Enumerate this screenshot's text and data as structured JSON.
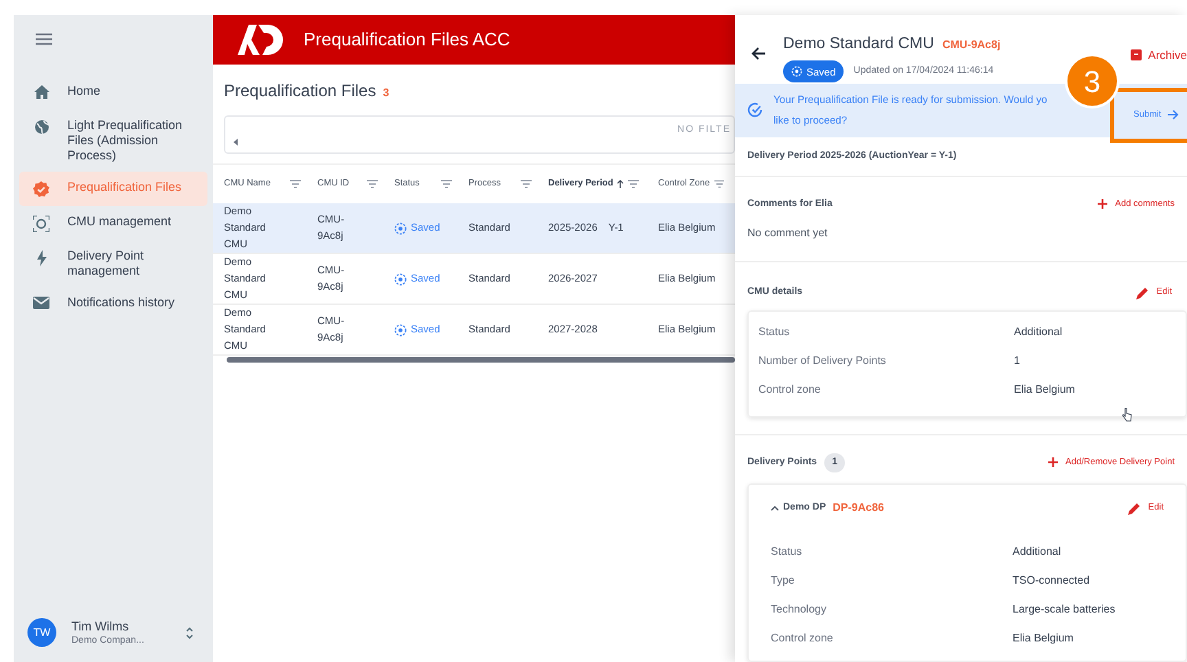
{
  "sidebar": {
    "items": [
      {
        "label": "Home",
        "selected": false
      },
      {
        "label": "Light Prequalification Files (Admission Process)",
        "selected": false
      },
      {
        "label": "Prequalification Files",
        "selected": true
      },
      {
        "label": "CMU management",
        "selected": false
      },
      {
        "label": "Delivery Point management",
        "selected": false
      },
      {
        "label": "Notifications history",
        "selected": false
      }
    ],
    "user": {
      "initials": "TW",
      "name": "Tim Wilms",
      "company": "Demo Compan..."
    }
  },
  "header": {
    "title": "Prequalification Files ACC"
  },
  "page": {
    "title": "Prequalification Files",
    "count": "3",
    "filter_text": "NO FILTE"
  },
  "table": {
    "columns": [
      {
        "label": "CMU Name",
        "sorted": false
      },
      {
        "label": "CMU ID",
        "sorted": false
      },
      {
        "label": "Status",
        "sorted": false
      },
      {
        "label": "Process",
        "sorted": false
      },
      {
        "label": "Delivery Period",
        "sorted": true
      },
      {
        "label": "Control Zone",
        "sorted": false
      }
    ],
    "rows": [
      {
        "selected": true,
        "cmu_name": "Demo Standard CMU",
        "cmu_id": "CMU-9Ac8j",
        "status": "Saved",
        "process": "Standard",
        "delivery_period": "2025-2026",
        "auction_year": "Y-1",
        "control_zone": "Elia Belgium"
      },
      {
        "selected": false,
        "cmu_name": "Demo Standard CMU",
        "cmu_id": "CMU-9Ac8j",
        "status": "Saved",
        "process": "Standard",
        "delivery_period": "2026-2027",
        "control_zone": "Elia Belgium"
      },
      {
        "selected": false,
        "cmu_name": "Demo Standard CMU",
        "cmu_id": "CMU-9Ac8j",
        "status": "Saved",
        "process": "Standard",
        "delivery_period": "2027-2028",
        "control_zone": "Elia Belgium"
      }
    ]
  },
  "detail": {
    "title": "Demo Standard CMU",
    "code": "CMU-9Ac8j",
    "status": "Saved",
    "updated": "Updated on 17/04/2024 11:46:14",
    "archive": "Archive",
    "banner": {
      "lines": [
        "Your Prequalification File is ready for submission. Would yo",
        "like to proceed?"
      ],
      "action": "Submit"
    },
    "step": {
      "number": "3"
    },
    "delivery_period": "Delivery Period 2025-2026 (AuctionYear = Y-1)",
    "comments": {
      "title": "Comments for Elia",
      "action": "Add comments",
      "text": "No comment yet"
    },
    "cmu_details": {
      "title": "CMU details",
      "action": "Edit",
      "fields": [
        {
          "label": "Status",
          "value": "Additional"
        },
        {
          "label": "Number of Delivery Points",
          "value": "1"
        },
        {
          "label": "Control zone",
          "value": "Elia Belgium"
        }
      ]
    },
    "delivery_points": {
      "title": "Delivery Points",
      "count": "1",
      "action": "Add/Remove Delivery Point",
      "items": [
        {
          "name": "Demo DP",
          "code": "DP-9Ac86",
          "expanded": true,
          "action": "Edit",
          "fields": [
            {
              "label": "Status",
              "value": "Additional"
            },
            {
              "label": "Type",
              "value": "TSO-connected"
            },
            {
              "label": "Technology",
              "value": "Large-scale batteries"
            },
            {
              "label": "Control zone",
              "value": "Elia Belgium"
            }
          ]
        }
      ]
    }
  }
}
